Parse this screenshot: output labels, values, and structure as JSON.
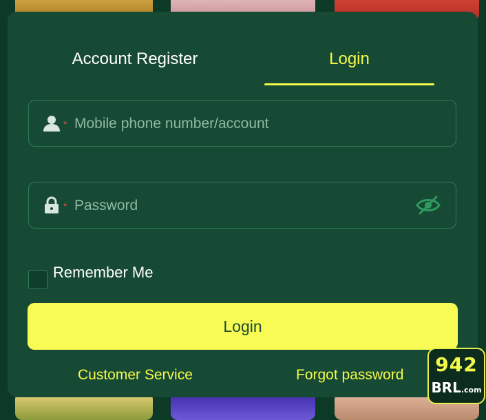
{
  "tabs": {
    "register_label": "Account Register",
    "login_label": "Login",
    "active": "Login"
  },
  "account_field": {
    "icon": "user-icon",
    "required_mark": "*",
    "placeholder": "Mobile phone number/account",
    "value": ""
  },
  "password_field": {
    "icon": "lock-icon",
    "required_mark": "*",
    "placeholder": "Password",
    "value": "",
    "toggle_icon": "eye-off-icon"
  },
  "remember": {
    "label": "Remember Me",
    "checked": false
  },
  "login_button_label": "Login",
  "links": {
    "customer_service": "Customer Service",
    "forgot_password": "Forgot password"
  },
  "brand": {
    "number": "942",
    "name": "BRL",
    "suffix": ".com"
  },
  "colors": {
    "modal_bg": "#174a35",
    "accent": "#f4fa4a",
    "button_bg": "#f8fb54",
    "required": "#e24a3b"
  }
}
